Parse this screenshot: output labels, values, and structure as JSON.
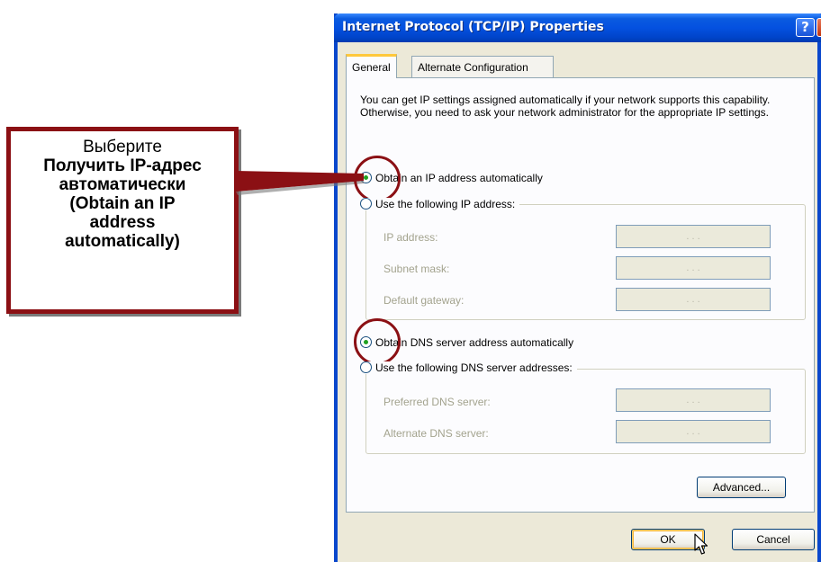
{
  "callout": {
    "line1": "Выберите",
    "line2": "Получить IP-адрес",
    "line3": "автоматически",
    "line4": "(Obtain an IP",
    "line5": "address",
    "line6": "automatically)"
  },
  "window": {
    "title": "Internet Protocol (TCP/IP) Properties",
    "help_glyph": "?",
    "close_glyph": "✕"
  },
  "tabs": [
    {
      "label": "General",
      "active": true
    },
    {
      "label": "Alternate Configuration",
      "active": false
    }
  ],
  "general": {
    "intro": "You can get IP settings assigned automatically if your network supports this capability. Otherwise, you need to ask your network administrator for the appropriate IP settings.",
    "ip_auto_label": "Obtain an IP address automatically",
    "ip_manual_label": "Use the following IP address:",
    "ip_fields": [
      {
        "label": "IP address:",
        "value": ""
      },
      {
        "label": "Subnet mask:",
        "value": ""
      },
      {
        "label": "Default gateway:",
        "value": ""
      }
    ],
    "dns_auto_label": "Obtain DNS server address automatically",
    "dns_manual_label": "Use the following DNS server addresses:",
    "dns_fields": [
      {
        "label": "Preferred DNS server:",
        "value": ""
      },
      {
        "label": "Alternate DNS server:",
        "value": ""
      }
    ],
    "ip_dots": ".  .  .",
    "advanced_label": "Advanced..."
  },
  "footer": {
    "ok_label": "OK",
    "cancel_label": "Cancel"
  },
  "colors": {
    "annotation": "#8b1014",
    "titlebar": "#0451e0",
    "dialog_bg": "#ece9d8"
  }
}
